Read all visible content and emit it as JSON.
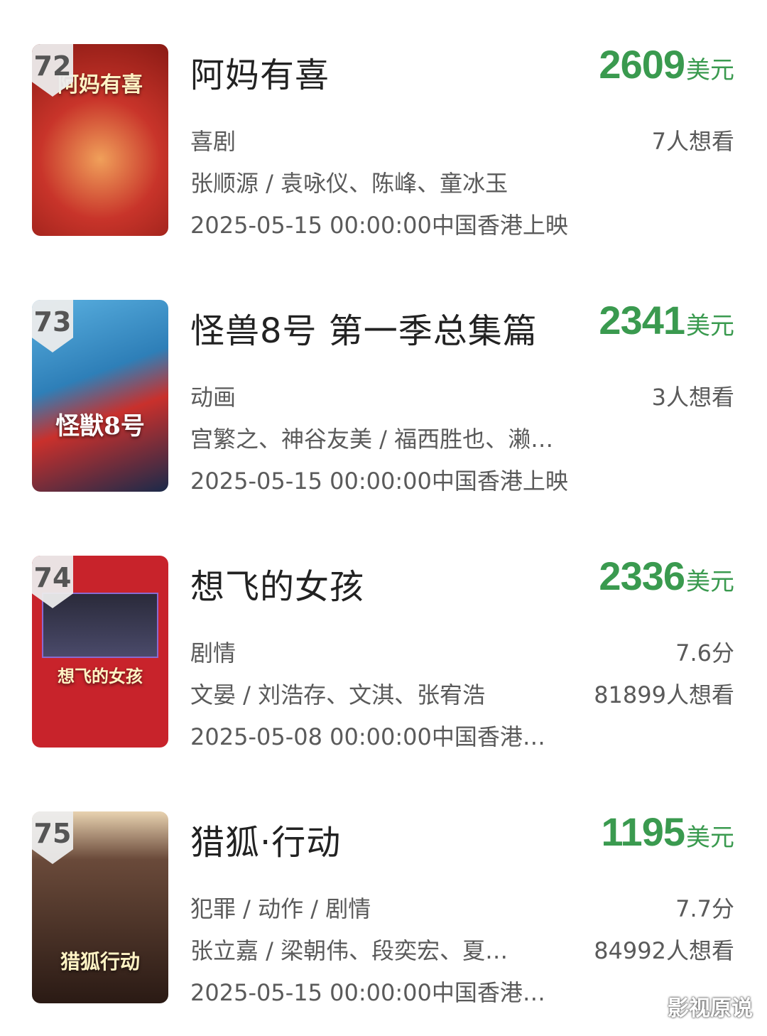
{
  "currency_unit": "美元",
  "colors": {
    "box_office_green": "#3a9a4f",
    "title_text": "#222222",
    "meta_text": "#5a5a5a",
    "rank_badge_bg": "#ececec"
  },
  "movies": [
    {
      "rank": "72",
      "title": "阿妈有喜",
      "box_office": "2609",
      "genre": "喜剧",
      "side_top": "7人想看",
      "cast": "张顺源 / 袁咏仪、陈峰、童冰玉",
      "side_bottom": "",
      "release": "2025-05-15 00:00:00中国香港上映",
      "poster_text": "阿妈有喜",
      "poster_color": "#b8261f"
    },
    {
      "rank": "73",
      "title": "怪兽8号 第一季总集篇",
      "box_office": "2341",
      "genre": "动画",
      "side_top": "3人想看",
      "cast": "宫繁之、神谷友美 / 福西胜也、濑…",
      "side_bottom": "",
      "release": "2025-05-15 00:00:00中国香港上映",
      "poster_text": "怪獣8号",
      "poster_color": "#2e7fb8"
    },
    {
      "rank": "74",
      "title": "想飞的女孩",
      "box_office": "2336",
      "genre": "剧情",
      "side_top": "7.6分",
      "cast": "文晏 / 刘浩存、文淇、张宥浩",
      "side_bottom": "81899人想看",
      "release": "2025-05-08 00:00:00中国香港…",
      "poster_text": "想飞的女孩",
      "poster_color": "#c8232b"
    },
    {
      "rank": "75",
      "title": "猎狐·行动",
      "box_office": "1195",
      "genre": "犯罪 / 动作 / 剧情",
      "side_top": "7.7分",
      "cast": "张立嘉 / 梁朝伟、段奕宏、夏…",
      "side_bottom": "84992人想看",
      "release": "2025-05-15 00:00:00中国香港…",
      "poster_text": "猎狐行动",
      "poster_color": "#3a2a24"
    }
  ],
  "watermark": "影视原说"
}
